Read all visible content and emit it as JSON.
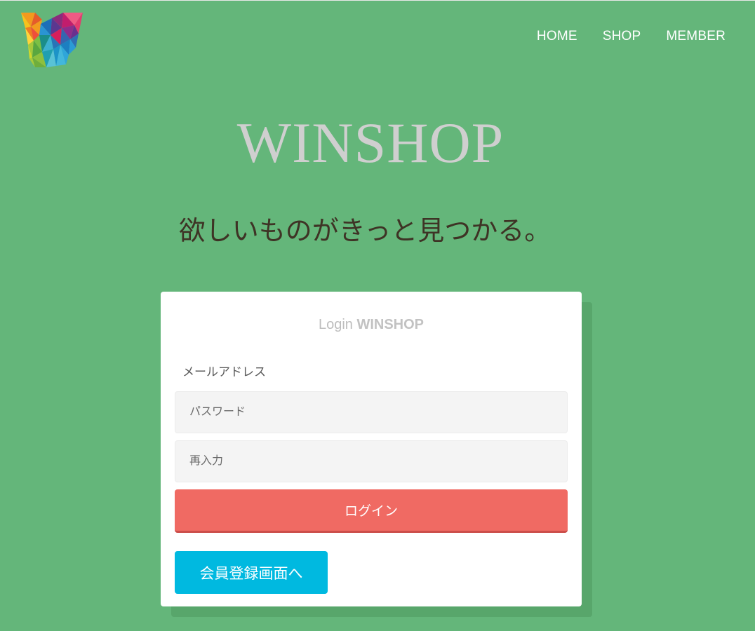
{
  "nav": {
    "items": [
      "HOME",
      "SHOP",
      "MEMBER"
    ]
  },
  "hero": {
    "title": "WINSHOP",
    "tagline": "欲しいものがきっと見つかる。"
  },
  "login": {
    "heading_prefix": "Login",
    "heading_brand": "WINSHOP",
    "email_label": "メールアドレス",
    "password_placeholder": "パスワード",
    "reenter_placeholder": "再入力",
    "login_button": "ログイン",
    "register_button": "会員登録画面へ"
  },
  "colors": {
    "background": "#64b67a",
    "login_button": "#f06a63",
    "register_button": "#00b9e0",
    "title": "#cfcfcf"
  }
}
